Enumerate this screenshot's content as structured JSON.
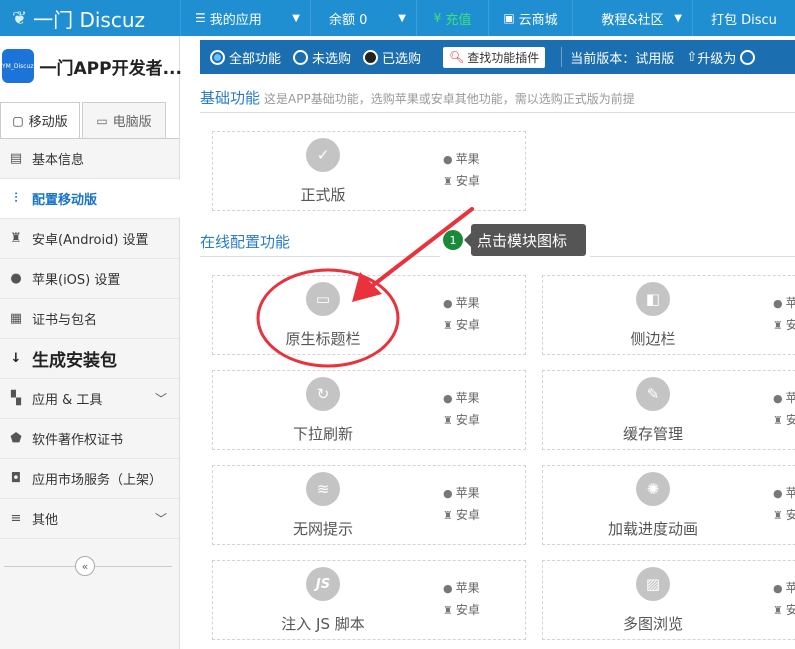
{
  "topbar": {
    "logo": "一门 Discuz",
    "my_apps": "我的应用",
    "balance": "余额 0",
    "recharge": "充值",
    "cloud_store": "云商城",
    "community": "教程&社区",
    "package": "打包 Discu"
  },
  "sidebar": {
    "app_icon_text": "YM_Discuz",
    "app_name": "一门APP开发者...",
    "tabs": [
      "移动版",
      "电脑版"
    ],
    "items": [
      {
        "label": "基本信息",
        "icon": "document-icon"
      },
      {
        "label": "配置移动版",
        "icon": "sliders-icon"
      },
      {
        "label": "安卓(Android) 设置",
        "icon": "android-icon"
      },
      {
        "label": "苹果(iOS) 设置",
        "icon": "apple-icon"
      },
      {
        "label": "证书与包名",
        "icon": "certificate-icon"
      },
      {
        "label": "生成安装包",
        "icon": "sort-icon"
      },
      {
        "label": "应用 & 工具",
        "icon": "grid-icon"
      },
      {
        "label": "软件著作权证书",
        "icon": "copyright-icon"
      },
      {
        "label": "应用市场服务（上架）",
        "icon": "store-icon"
      },
      {
        "label": "其他",
        "icon": "menu-icon"
      }
    ]
  },
  "toolbar": {
    "all": "全部功能",
    "unselected": "未选购",
    "selected": "已选购",
    "search": "查找功能插件",
    "version": "当前版本：试用版",
    "upgrade": "升级为"
  },
  "sections": {
    "basic_title": "基础功能",
    "basic_desc": "这是APP基础功能，选购苹果或安卓其他功能，需以选购正式版为前提",
    "online_title": "在线配置功能"
  },
  "platforms": {
    "apple": "苹果",
    "android": "安卓"
  },
  "cards": {
    "official": "正式版",
    "native_titlebar": "原生标题栏",
    "sidebar": "侧边栏",
    "pull_refresh": "下拉刷新",
    "cache_mgmt": "缓存管理",
    "no_network": "无网提示",
    "loading_anim": "加载进度动画",
    "inject_js": "注入 JS 脚本",
    "multi_image": "多图浏览"
  },
  "tip": {
    "step": "1",
    "text": "点击模块图标"
  },
  "colors": {
    "topbar": "#1f8fd1",
    "toolbar": "#1b6fb0",
    "accent": "#2a7cc7",
    "annotation": "#e8323c"
  }
}
